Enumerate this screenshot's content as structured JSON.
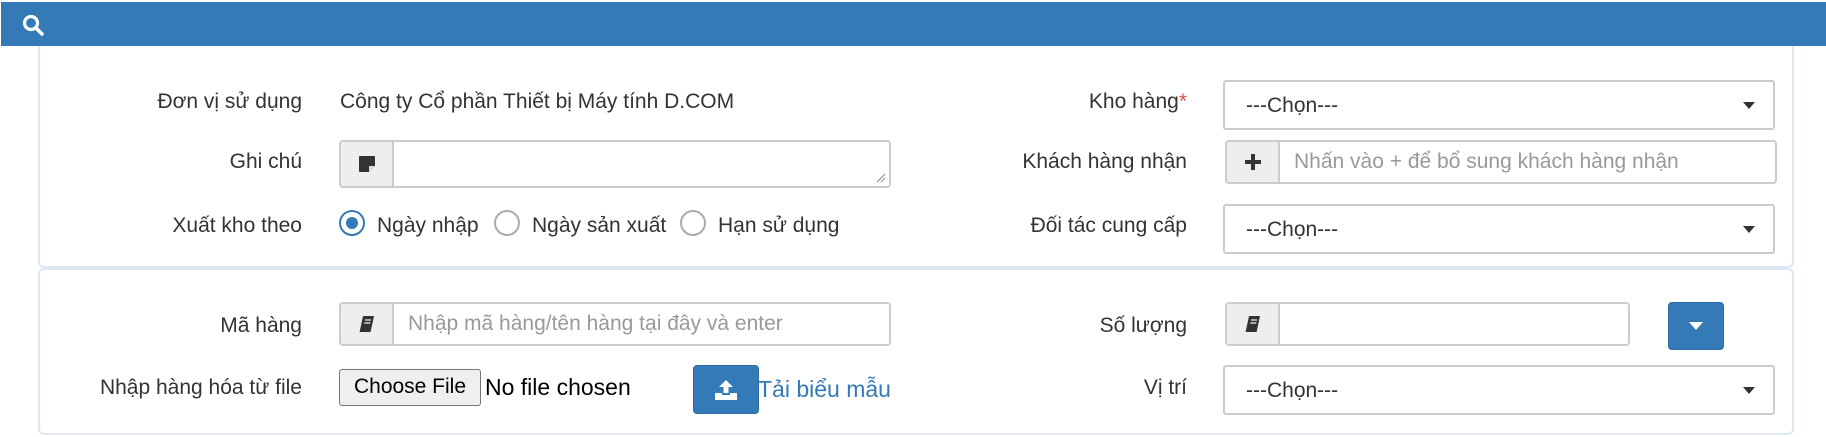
{
  "icons": {
    "search": "search-icon",
    "note": "sticky-note-icon",
    "plus": "plus-icon",
    "book": "book-icon",
    "caret": "caret-down-icon",
    "upload": "upload-icon"
  },
  "colors": {
    "primary": "#337ab7",
    "required": "#d9534f"
  },
  "general": {
    "unit_label": "Đơn vị sử dụng",
    "unit_value": "Công ty Cổ phần Thiết bị Máy tính D.COM",
    "note_label": "Ghi chú",
    "note_value": "",
    "export_label": "Xuất kho theo",
    "export_options": [
      "Ngày nhập",
      "Ngày sản xuất",
      "Hạn sử dụng"
    ],
    "export_selected": "Ngày nhập",
    "warehouse_label": "Kho hàng",
    "required_mark": "*",
    "warehouse_value": "---Chọn---",
    "customer_label": "Khách hàng nhận",
    "customer_placeholder": "Nhấn vào + để bổ sung khách hàng nhận",
    "supplier_label": "Đối tác cung cấp",
    "supplier_value": "---Chọn---"
  },
  "items": {
    "code_label": "Mã hàng",
    "code_placeholder": "Nhập mã hàng/tên hàng tại đây và enter",
    "file_label": "Nhập hàng hóa từ file",
    "choose_file_label": "Choose File",
    "file_status": "No file chosen",
    "template_link": "Tải biểu mẫu",
    "quantity_label": "Số lượng",
    "quantity_value": "",
    "location_label": "Vị trí",
    "location_value": "---Chọn---"
  }
}
